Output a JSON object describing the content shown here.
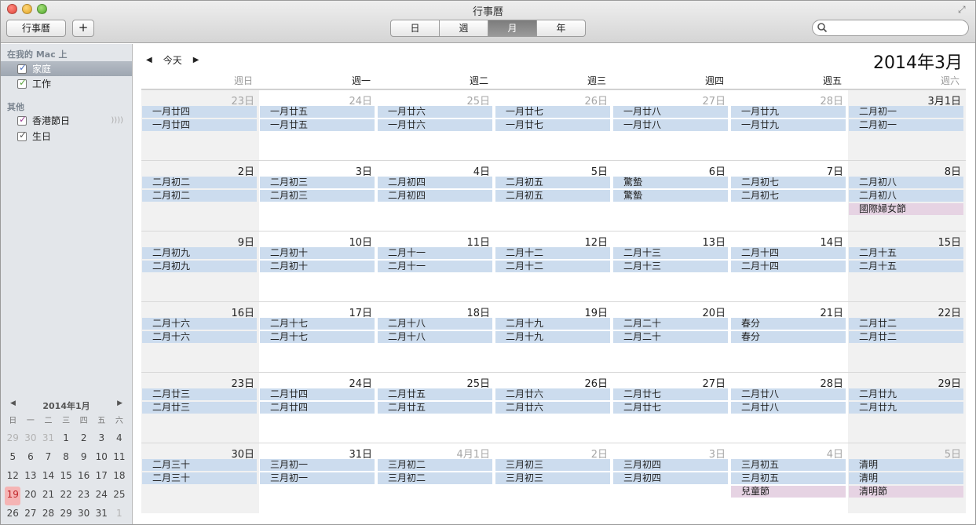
{
  "window": {
    "title": "行事曆",
    "calendars_button": "行事曆",
    "add_button": "+",
    "views": [
      {
        "label": "日",
        "active": false
      },
      {
        "label": "週",
        "active": false
      },
      {
        "label": "月",
        "active": true
      },
      {
        "label": "年",
        "active": false
      }
    ],
    "search_placeholder": ""
  },
  "sidebar": {
    "groups": [
      {
        "title": "在我的 Mac 上",
        "items": [
          {
            "label": "家庭",
            "checked": true,
            "color": "#4a6fc1",
            "selected": true
          },
          {
            "label": "工作",
            "checked": true,
            "color": "#5aa33a",
            "selected": false
          }
        ]
      },
      {
        "title": "其他",
        "items": [
          {
            "label": "香港節日",
            "checked": true,
            "color": "#9c3f96",
            "selected": false,
            "feed": true
          },
          {
            "label": "生日",
            "checked": true,
            "color": "#555555",
            "selected": false
          }
        ]
      }
    ]
  },
  "mini_calendar": {
    "title": "2014年1月",
    "dow": [
      "日",
      "一",
      "二",
      "三",
      "四",
      "五",
      "六"
    ],
    "days": [
      {
        "d": "29",
        "dim": true
      },
      {
        "d": "30",
        "dim": true
      },
      {
        "d": "31",
        "dim": true
      },
      {
        "d": "1"
      },
      {
        "d": "2"
      },
      {
        "d": "3"
      },
      {
        "d": "4"
      },
      {
        "d": "5"
      },
      {
        "d": "6"
      },
      {
        "d": "7"
      },
      {
        "d": "8"
      },
      {
        "d": "9"
      },
      {
        "d": "10"
      },
      {
        "d": "11"
      },
      {
        "d": "12"
      },
      {
        "d": "13"
      },
      {
        "d": "14"
      },
      {
        "d": "15"
      },
      {
        "d": "16"
      },
      {
        "d": "17"
      },
      {
        "d": "18"
      },
      {
        "d": "19",
        "today": true
      },
      {
        "d": "20"
      },
      {
        "d": "21"
      },
      {
        "d": "22"
      },
      {
        "d": "23"
      },
      {
        "d": "24"
      },
      {
        "d": "25"
      },
      {
        "d": "26"
      },
      {
        "d": "27"
      },
      {
        "d": "28"
      },
      {
        "d": "29"
      },
      {
        "d": "30"
      },
      {
        "d": "31"
      },
      {
        "d": "1",
        "dim": true
      }
    ]
  },
  "main": {
    "today_label": "今天",
    "month_title": "2014年3月",
    "weekdays": [
      "週日",
      "週一",
      "週二",
      "週三",
      "週四",
      "週五",
      "週六"
    ],
    "weeks": [
      [
        {
          "n": "23日",
          "dim": true,
          "events": [
            "一月廿四",
            "一月廿四"
          ]
        },
        {
          "n": "24日",
          "dim": true,
          "events": [
            "一月廿五",
            "一月廿五"
          ]
        },
        {
          "n": "25日",
          "dim": true,
          "events": [
            "一月廿六",
            "一月廿六"
          ]
        },
        {
          "n": "26日",
          "dim": true,
          "events": [
            "一月廿七",
            "一月廿七"
          ]
        },
        {
          "n": "27日",
          "dim": true,
          "events": [
            "一月廿八",
            "一月廿八"
          ]
        },
        {
          "n": "28日",
          "dim": true,
          "events": [
            "一月廿九",
            "一月廿九"
          ]
        },
        {
          "n": "3月1日",
          "events": [
            "二月初一",
            "二月初一"
          ]
        }
      ],
      [
        {
          "n": "2日",
          "events": [
            "二月初二",
            "二月初二"
          ]
        },
        {
          "n": "3日",
          "events": [
            "二月初三",
            "二月初三"
          ]
        },
        {
          "n": "4日",
          "events": [
            "二月初四",
            "二月初四"
          ]
        },
        {
          "n": "5日",
          "events": [
            "二月初五",
            "二月初五"
          ]
        },
        {
          "n": "6日",
          "events": [
            "驚蟄",
            "驚蟄"
          ]
        },
        {
          "n": "7日",
          "events": [
            "二月初七",
            "二月初七"
          ]
        },
        {
          "n": "8日",
          "events": [
            "二月初八",
            "二月初八"
          ],
          "holiday": "國際婦女節"
        }
      ],
      [
        {
          "n": "9日",
          "events": [
            "二月初九",
            "二月初九"
          ]
        },
        {
          "n": "10日",
          "events": [
            "二月初十",
            "二月初十"
          ]
        },
        {
          "n": "11日",
          "events": [
            "二月十一",
            "二月十一"
          ]
        },
        {
          "n": "12日",
          "events": [
            "二月十二",
            "二月十二"
          ]
        },
        {
          "n": "13日",
          "events": [
            "二月十三",
            "二月十三"
          ]
        },
        {
          "n": "14日",
          "events": [
            "二月十四",
            "二月十四"
          ]
        },
        {
          "n": "15日",
          "events": [
            "二月十五",
            "二月十五"
          ]
        }
      ],
      [
        {
          "n": "16日",
          "events": [
            "二月十六",
            "二月十六"
          ]
        },
        {
          "n": "17日",
          "events": [
            "二月十七",
            "二月十七"
          ]
        },
        {
          "n": "18日",
          "events": [
            "二月十八",
            "二月十八"
          ]
        },
        {
          "n": "19日",
          "events": [
            "二月十九",
            "二月十九"
          ]
        },
        {
          "n": "20日",
          "events": [
            "二月二十",
            "二月二十"
          ]
        },
        {
          "n": "21日",
          "events": [
            "春分",
            "春分"
          ]
        },
        {
          "n": "22日",
          "events": [
            "二月廿二",
            "二月廿二"
          ]
        }
      ],
      [
        {
          "n": "23日",
          "events": [
            "二月廿三",
            "二月廿三"
          ]
        },
        {
          "n": "24日",
          "events": [
            "二月廿四",
            "二月廿四"
          ]
        },
        {
          "n": "25日",
          "events": [
            "二月廿五",
            "二月廿五"
          ]
        },
        {
          "n": "26日",
          "events": [
            "二月廿六",
            "二月廿六"
          ]
        },
        {
          "n": "27日",
          "events": [
            "二月廿七",
            "二月廿七"
          ]
        },
        {
          "n": "28日",
          "events": [
            "二月廿八",
            "二月廿八"
          ]
        },
        {
          "n": "29日",
          "events": [
            "二月廿九",
            "二月廿九"
          ]
        }
      ],
      [
        {
          "n": "30日",
          "events": [
            "二月三十",
            "二月三十"
          ]
        },
        {
          "n": "31日",
          "events": [
            "三月初一",
            "三月初一"
          ]
        },
        {
          "n": "4月1日",
          "dim": true,
          "events": [
            "三月初二",
            "三月初二"
          ]
        },
        {
          "n": "2日",
          "dim": true,
          "events": [
            "三月初三",
            "三月初三"
          ]
        },
        {
          "n": "3日",
          "dim": true,
          "events": [
            "三月初四",
            "三月初四"
          ]
        },
        {
          "n": "4日",
          "dim": true,
          "events": [
            "三月初五",
            "三月初五"
          ],
          "holiday": "兒童節"
        },
        {
          "n": "5日",
          "dim": true,
          "events": [
            "清明",
            "清明"
          ],
          "holiday": "清明節"
        }
      ]
    ]
  },
  "colors": {
    "event_bg": "#ccdcee",
    "holiday_bg": "#e6d3e3",
    "weekend_bg": "#f1f1f1",
    "today_mini": "#f5b4b4"
  }
}
